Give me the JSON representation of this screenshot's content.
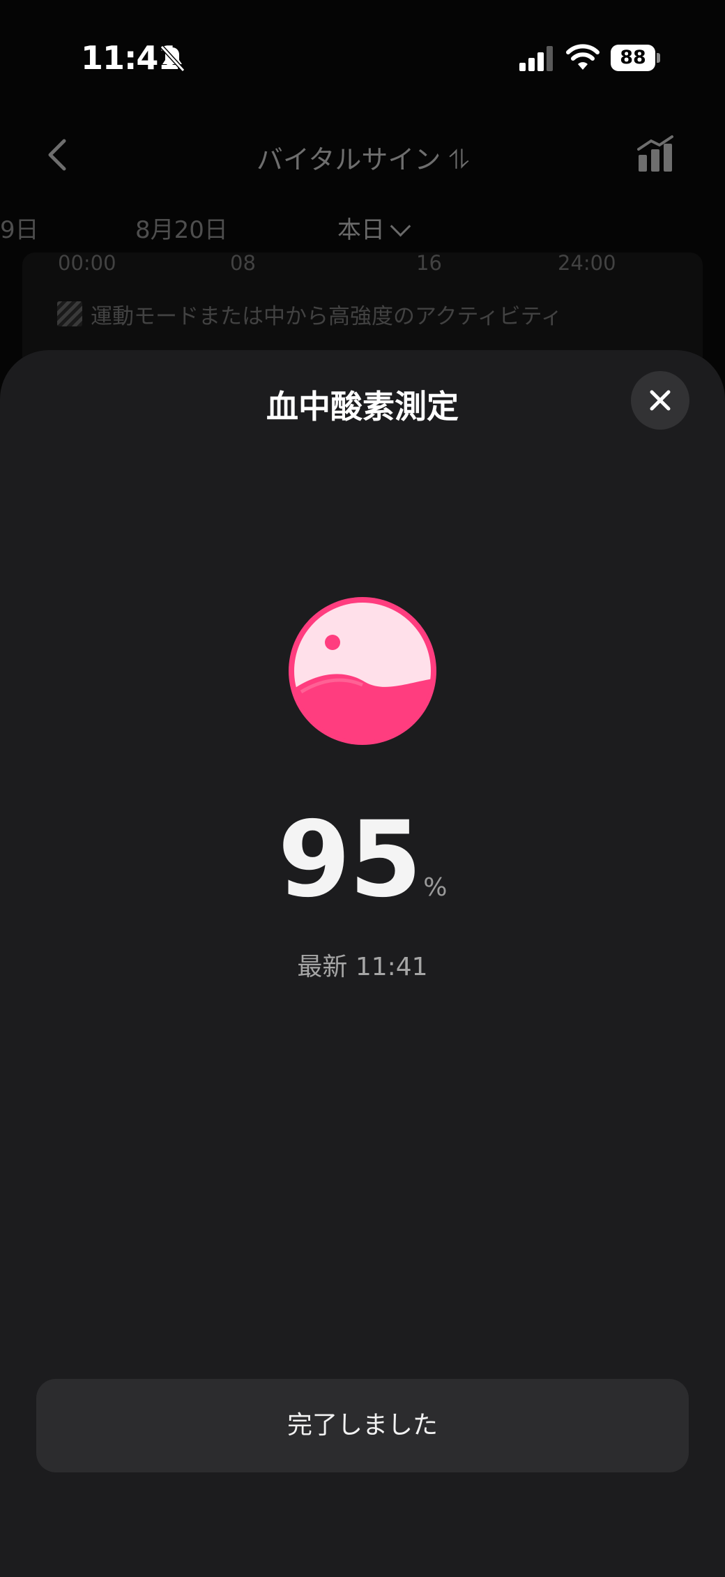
{
  "status_bar": {
    "time": "11:41",
    "battery": "88"
  },
  "background_page": {
    "title": "バイタルサイン ⥮",
    "date_tabs": [
      "9日",
      "8月20日",
      "本日"
    ],
    "axis_ticks": [
      "00:00",
      "08",
      "16",
      "24:00"
    ],
    "legend": "運動モードまたは中から高強度のアクティビティ"
  },
  "sheet": {
    "title": "血中酸素測定",
    "value": "95",
    "unit": "%",
    "latest": "最新 11:41",
    "done_label": "完了しました"
  },
  "colors": {
    "accent": "#ff3d7f",
    "orb_light": "#ffe0ea",
    "sheet_bg": "#1c1c1e"
  }
}
